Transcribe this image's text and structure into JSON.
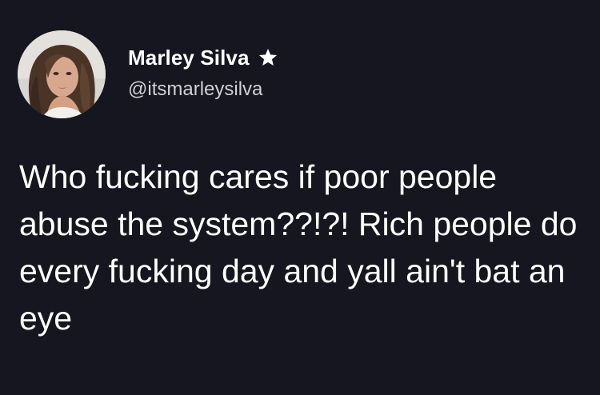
{
  "user": {
    "display_name": "Marley Silva",
    "handle": "@itsmarleysilva",
    "badge_icon": "star-icon"
  },
  "tweet": {
    "text": "Who fucking cares if poor people abuse the system??!?! Rich people do every fucking day and yall ain't bat an eye"
  },
  "colors": {
    "background": "#15161f",
    "text": "#ffffff",
    "handle": "#cfd0d6"
  }
}
